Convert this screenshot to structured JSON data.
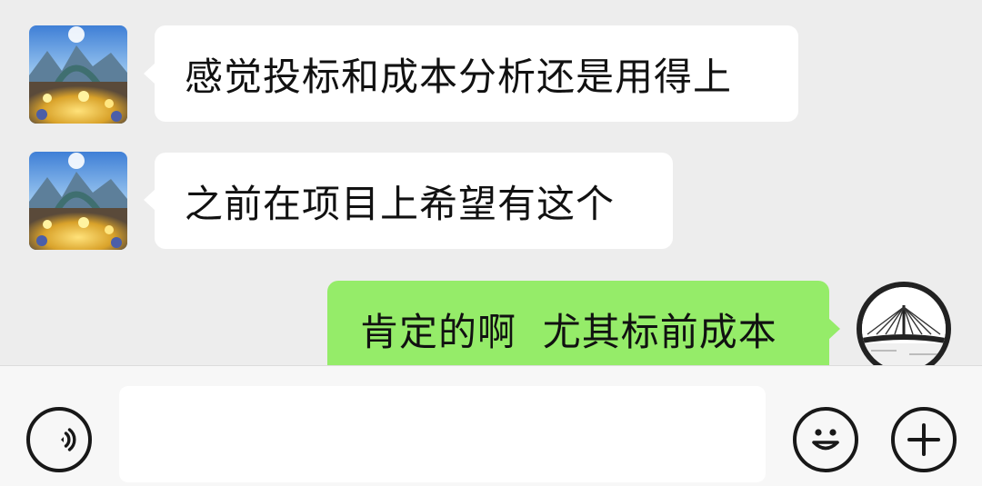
{
  "messages": [
    {
      "direction": "incoming",
      "avatar": "landscape-avatar",
      "text": "感觉投标和成本分析还是用得上"
    },
    {
      "direction": "incoming",
      "avatar": "landscape-avatar",
      "text": "之前在项目上希望有这个"
    },
    {
      "direction": "outgoing",
      "avatar": "bridge-avatar",
      "text": "肯定的啊  尤其标前成本"
    }
  ],
  "input_bar": {
    "voice_icon": "voice-icon",
    "text_value": "",
    "emoji_icon": "emoji-icon",
    "plus_icon": "plus-icon"
  },
  "colors": {
    "chat_background": "#ededed",
    "incoming_bubble": "#ffffff",
    "outgoing_bubble": "#95ec69",
    "input_bar_background": "#f7f7f7"
  }
}
